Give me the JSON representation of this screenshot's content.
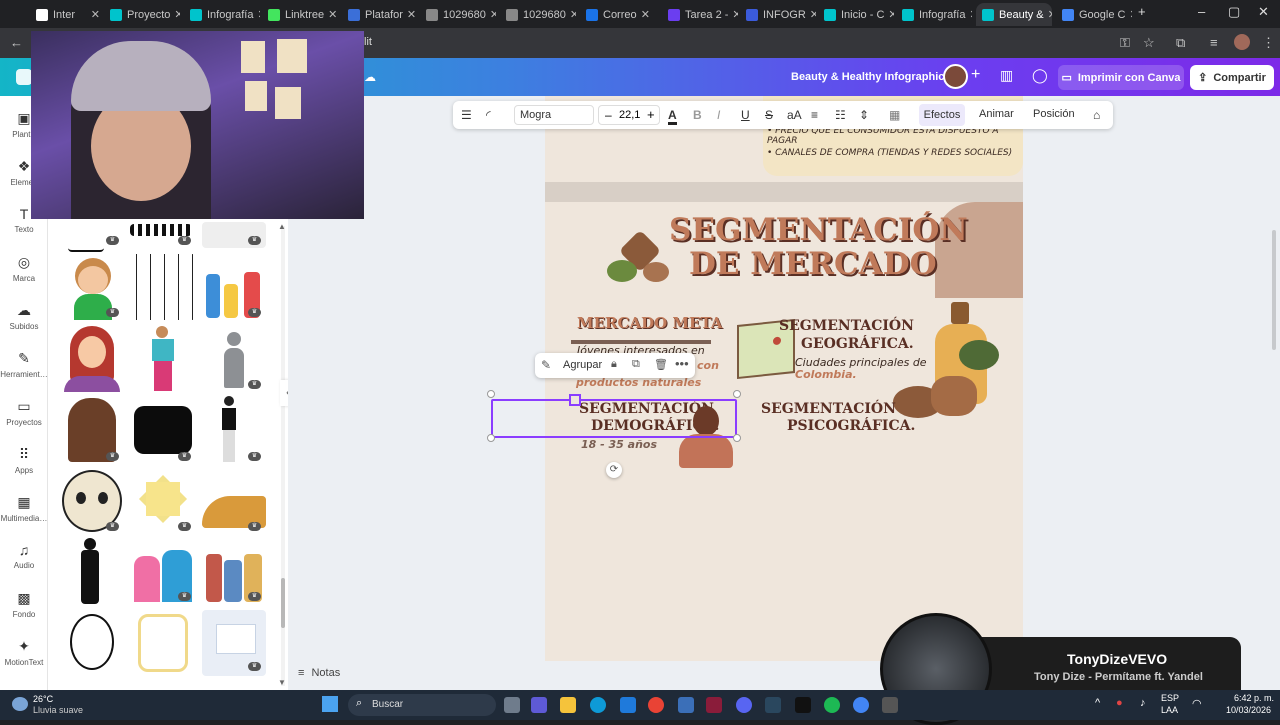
{
  "browser": {
    "tabs": [
      {
        "label": "Inter",
        "color": "#ffffff"
      },
      {
        "label": "Proyecto",
        "color": "#00c4cc"
      },
      {
        "label": "Infografía",
        "color": "#00c4cc"
      },
      {
        "label": "Linktree",
        "color": "#43e55e"
      },
      {
        "label": "Platafor",
        "color": "#3b6fd8"
      },
      {
        "label": "1029680",
        "color": "#888888"
      },
      {
        "label": "1029680",
        "color": "#888888"
      },
      {
        "label": "Correo",
        "color": "#1a73e8"
      },
      {
        "label": "Tarea 2 -",
        "color": "#6b3ef0"
      },
      {
        "label": "INFOGR",
        "color": "#3b5bdb"
      },
      {
        "label": "Inicio - C",
        "color": "#00c4cc"
      },
      {
        "label": "Infografía",
        "color": "#00c4cc"
      },
      {
        "label": "Beauty &",
        "color": "#00c4cc"
      },
      {
        "label": "Google C",
        "color": "#4285f4"
      }
    ],
    "new_tab": "+",
    "address_fragment": "lit"
  },
  "header": {
    "title": "Beauty & Healthy Infographic",
    "print_label": "Imprimir con Canva",
    "share_label": "Compartir"
  },
  "text_toolbar": {
    "font": "Mogra",
    "size": "22,1",
    "minus": "–",
    "plus": "+",
    "effects": "Efectos",
    "animate": "Animar",
    "position": "Posición"
  },
  "rail": [
    {
      "label": "Plantill",
      "icon": "template-icon"
    },
    {
      "label": "Elemen",
      "icon": "elements-icon"
    },
    {
      "label": "Texto",
      "icon": "text-icon"
    },
    {
      "label": "Marca",
      "icon": "brand-icon"
    },
    {
      "label": "Subidos",
      "icon": "upload-icon"
    },
    {
      "label": "Herramient…",
      "icon": "tools-icon"
    },
    {
      "label": "Proyectos",
      "icon": "folder-icon"
    },
    {
      "label": "Apps",
      "icon": "apps-icon"
    },
    {
      "label": "Multimedia…",
      "icon": "media-icon"
    },
    {
      "label": "Audio",
      "icon": "audio-icon"
    },
    {
      "label": "Fondo",
      "icon": "background-icon"
    },
    {
      "label": "MotionText",
      "icon": "motiontext-icon"
    }
  ],
  "design": {
    "bullet1": "PRECIO QUE EL CONSUMIDOR ESTÁ DISPUESTO A PAGAR",
    "bullet2": "CANALES DE COMPRA (TIENDAS Y REDES SOCIALES)",
    "title_line1": "SEGMENTACIÓN",
    "title_line2": "DE MERCADO",
    "mercado_meta": "MERCADO META",
    "meta_line1": "Jóvenes interesados en",
    "meta_line2": "con",
    "meta_line3": "productos naturales",
    "geo_line1": "SEGMENTACIÓN",
    "geo_line2": "GEOGRÁFICA.",
    "geo_desc1": "Ciudades principales de",
    "geo_desc2": "Colombia.",
    "demo_line1": "SEGMENTACIÓN",
    "demo_line2": "DEMOGRÁFICA.",
    "demo_desc": "18 - 35 años",
    "psico_line1": "SEGMENTACIÓN",
    "psico_line2": "PSICOGRÁFICA."
  },
  "floating_menu": {
    "group_label": "Agrupar"
  },
  "notes_label": "Notas",
  "notification": {
    "channel": "TonyDizeVEVO",
    "track": "Tony Dize - Permítame ft. Yandel"
  },
  "taskbar": {
    "weather_temp": "26°C",
    "weather_desc": "Lluvia suave",
    "search": "Buscar",
    "lang1": "ESP",
    "lang2": "LAA",
    "time": "6:42 p. m.",
    "date": "10/03/2026"
  }
}
